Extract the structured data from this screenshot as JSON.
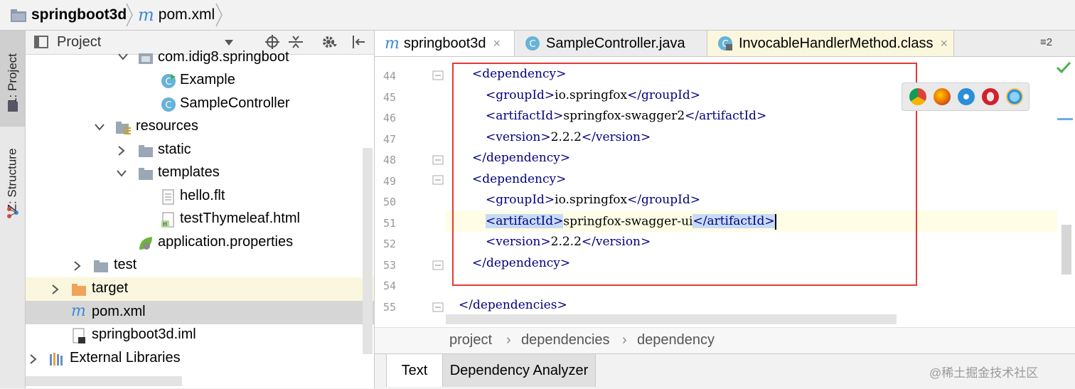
{
  "navbar": {
    "project_name": "springboot3d",
    "file_name": "pom.xml"
  },
  "left_strip": {
    "project_tab": "1: Project",
    "structure_tab": "Z: Structure"
  },
  "project_panel": {
    "title": "Project",
    "tree": [
      {
        "label": "com.idig8.springboot",
        "icon": "package-icon",
        "expanded": true
      },
      {
        "label": "Example",
        "icon": "java-class-run-icon"
      },
      {
        "label": "SampleController",
        "icon": "java-class-icon"
      },
      {
        "label": "resources",
        "icon": "resources-folder-icon",
        "expanded": true
      },
      {
        "label": "static",
        "icon": "folder-icon",
        "expanded": false
      },
      {
        "label": "templates",
        "icon": "folder-icon",
        "expanded": true
      },
      {
        "label": "hello.flt",
        "icon": "text-file-icon"
      },
      {
        "label": "testThymeleaf.html",
        "icon": "html-file-icon"
      },
      {
        "label": "application.properties",
        "icon": "spring-properties-icon"
      },
      {
        "label": "test",
        "icon": "folder-icon",
        "expanded": false
      },
      {
        "label": "target",
        "icon": "orange-folder-icon",
        "expanded": false
      },
      {
        "label": "pom.xml",
        "icon": "maven-icon"
      },
      {
        "label": "springboot3d.iml",
        "icon": "iml-file-icon"
      },
      {
        "label": "External Libraries",
        "icon": "libraries-icon",
        "expanded": false
      }
    ]
  },
  "editor_tabs": [
    {
      "label": "springboot3d",
      "icon": "maven-icon",
      "close": "×",
      "active": true
    },
    {
      "label": "SampleController.java",
      "icon": "java-class-icon",
      "active": false
    },
    {
      "label": "InvocableHandlerMethod.class",
      "icon": "class-file-icon",
      "close": "×",
      "active": false
    }
  ],
  "tab_overflow": "≡2",
  "editor": {
    "lines": [
      {
        "num": "44",
        "parts": [
          [
            "tag",
            "<dependency>"
          ]
        ]
      },
      {
        "num": "45",
        "parts": [
          [
            "tag",
            "<groupId>"
          ],
          [
            "text",
            "io.springfox"
          ],
          [
            "tag",
            "</groupId>"
          ]
        ]
      },
      {
        "num": "46",
        "parts": [
          [
            "tag",
            "<artifactId>"
          ],
          [
            "text",
            "springfox-swagger2"
          ],
          [
            "tag",
            "</artifactId>"
          ]
        ]
      },
      {
        "num": "47",
        "parts": [
          [
            "tag",
            "<version>"
          ],
          [
            "text",
            "2.2.2"
          ],
          [
            "tag",
            "</version>"
          ]
        ]
      },
      {
        "num": "48",
        "parts": [
          [
            "tag",
            "</dependency>"
          ]
        ]
      },
      {
        "num": "49",
        "parts": [
          [
            "tag",
            "<dependency>"
          ]
        ]
      },
      {
        "num": "50",
        "parts": [
          [
            "tag",
            "<groupId>"
          ],
          [
            "text",
            "io.springfox"
          ],
          [
            "tag",
            "</groupId>"
          ]
        ]
      },
      {
        "num": "51",
        "parts": [
          [
            "tag",
            "<artifactId>"
          ],
          [
            "text",
            "springfox-swagger-ui"
          ],
          [
            "tag",
            "</artifactId>"
          ]
        ]
      },
      {
        "num": "52",
        "parts": [
          [
            "tag",
            "<version>"
          ],
          [
            "text",
            "2.2.2"
          ],
          [
            "tag",
            "</version>"
          ]
        ]
      },
      {
        "num": "53",
        "parts": [
          [
            "tag",
            "</dependency>"
          ]
        ]
      },
      {
        "num": "54",
        "parts": []
      },
      {
        "num": "55",
        "parts": [
          [
            "tag",
            "</dependencies>"
          ]
        ]
      }
    ],
    "browsers": [
      "chrome-icon",
      "firefox-icon",
      "safari-icon",
      "opera-icon",
      "ie-icon"
    ]
  },
  "editor_breadcrumb": [
    "project",
    "dependencies",
    "dependency"
  ],
  "bottom_tabs": {
    "text": "Text",
    "dependency_analyzer": "Dependency Analyzer"
  },
  "watermark": "@稀土掘金技术社区",
  "colors": {
    "tag": "#000080",
    "selection": "#c7dbf7",
    "highlight_box": "#e53935",
    "current_line": "#fffde6"
  }
}
